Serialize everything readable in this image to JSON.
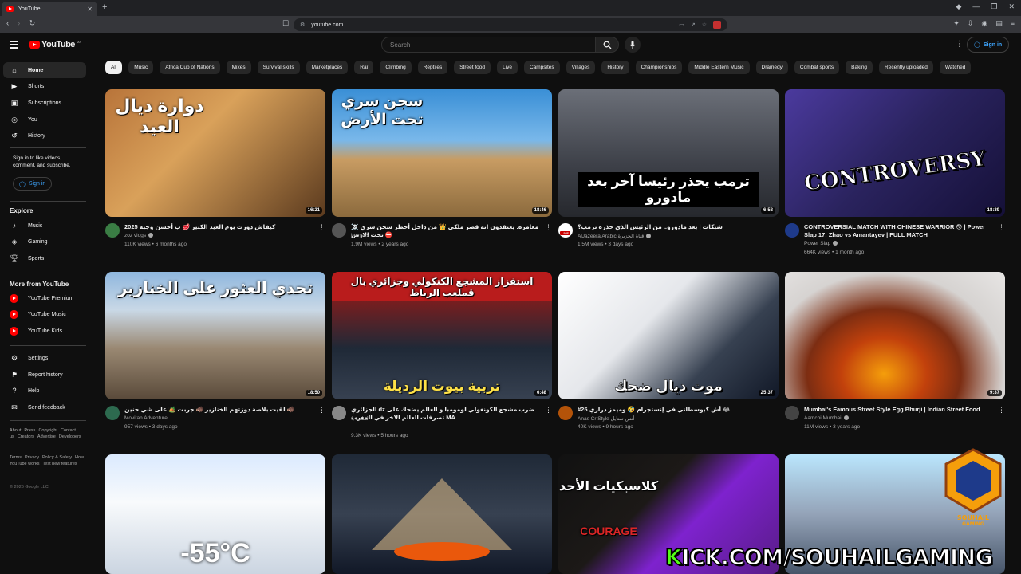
{
  "browser": {
    "tab_title": "YouTube",
    "url": "youtube.com"
  },
  "masthead": {
    "search_placeholder": "Search",
    "signin_label": "Sign in"
  },
  "sidebar": {
    "main": [
      {
        "label": "Home",
        "icon": "home-icon",
        "active": true
      },
      {
        "label": "Shorts",
        "icon": "shorts-icon"
      },
      {
        "label": "Subscriptions",
        "icon": "subscriptions-icon"
      },
      {
        "label": "You",
        "icon": "you-icon"
      },
      {
        "label": "History",
        "icon": "history-icon"
      }
    ],
    "signin_prompt": "Sign in to like videos, comment, and subscribe.",
    "signin_label": "Sign in",
    "explore_heading": "Explore",
    "explore": [
      {
        "label": "Music",
        "icon": "music-icon"
      },
      {
        "label": "Gaming",
        "icon": "gaming-icon"
      },
      {
        "label": "Sports",
        "icon": "sports-icon"
      }
    ],
    "more_heading": "More from YouTube",
    "more": [
      {
        "label": "YouTube Premium"
      },
      {
        "label": "YouTube Music"
      },
      {
        "label": "YouTube Kids"
      }
    ],
    "settings": [
      {
        "label": "Settings",
        "icon": "gear-icon"
      },
      {
        "label": "Report history",
        "icon": "flag-icon"
      },
      {
        "label": "Help",
        "icon": "help-icon"
      },
      {
        "label": "Send feedback",
        "icon": "feedback-icon"
      }
    ],
    "footer1": [
      "About",
      "Press",
      "Copyright",
      "Contact us",
      "Creators",
      "Advertise",
      "Developers"
    ],
    "footer2": [
      "Terms",
      "Privacy",
      "Policy & Safety",
      "How YouTube works",
      "Test new features"
    ],
    "copyright": "© 2026 Google LLC"
  },
  "chips": [
    "All",
    "Music",
    "Africa Cup of Nations",
    "Mixes",
    "Survival skills",
    "Marketplaces",
    "Raï",
    "Climbing",
    "Reptiles",
    "Street food",
    "Live",
    "Campsites",
    "Villages",
    "History",
    "Championships",
    "Middle Eastern Music",
    "Dramedy",
    "Combat sports",
    "Baking",
    "Recently uploaded",
    "Watched"
  ],
  "videos": [
    {
      "thumb_text": "دوارة ديال العيد",
      "duration": "16:21",
      "title": "كيفاش دوزت يوم العيد الكبير 🥩 ب أحسن وجبة 2025",
      "channel": "zoz vlogs",
      "stats": "110K views • 6 months ago",
      "avatar_color": "#3a7d44"
    },
    {
      "thumb_text": "سجن سري تحت الأرض",
      "duration": "18:46",
      "title": "☠️ مغامرة: يعتقدون انه قصر ملكي 👑 من داخل أخطر سجن سري تحت الارض ⛔",
      "channel": "bn nsns",
      "stats": "1.9M views • 2 years ago",
      "avatar_color": "#555"
    },
    {
      "thumb_text": "ترمب يحذر رئيسا آخر بعد مادورو",
      "duration": "6:58",
      "title": "شبكات | بعد مادورو.. من الرئيس الذي حذره ترمب؟",
      "channel": "AlJazeera Arabic قناة الجزيرة",
      "stats": "1.5M views • 3 days ago",
      "avatar_color": "#c8a14a"
    },
    {
      "thumb_text": "CONTROVERSY",
      "duration": "18:39",
      "title": "CONTROVERSIAL MATCH WITH CHINESE WARRIOR 😳 | Power Slap 17: Zhao vs Amantayev | FULL MATCH",
      "channel": "Power Slap",
      "stats": "664K views • 1 month ago",
      "avatar_color": "#1e3a8a"
    },
    {
      "thumb_text": "تحدي العثور على الخنازير",
      "duration": "18:50",
      "title": "لقيت بلاصة دوزتهم الخنازير 🐗 جربت 🏕️ على شي حنين 🐗",
      "channel": "Movitan Adventure",
      "stats": "957 views • 3 days ago",
      "avatar_color": "#2d6a4f"
    },
    {
      "thumb_text": "استفزاز المشجع الكنكولي وجزائري بال قملعب الرباط",
      "duration": "6:48",
      "title": "الجزائري dz ضرب مشجع الكونغولي لومومبا و العالم يضحك على تصرفات العالم الاخر في المغرب MA",
      "channel": "6 السعيد",
      "stats": "9.3K views • 5 hours ago",
      "avatar_color": "#888"
    },
    {
      "thumb_text": "موت ديال ضحك",
      "duration": "25:37",
      "title": "#25 أش كيوسطاني في إنستجرام 🤣 وميمز دراري 😂",
      "channel": "Anas Cr Style أنس ستايل",
      "stats": "40K views • 9 hours ago",
      "avatar_color": "#b45309"
    },
    {
      "thumb_text": "",
      "duration": "9:37",
      "title": "Mumbai's Famous Street Style Egg Bhurji | Indian Street Food",
      "channel": "Aamchi Mumbai",
      "stats": "11M views • 3 years ago",
      "avatar_color": "#444"
    }
  ],
  "overlay": {
    "kick_prefix": "K",
    "kick_rest": "ICK.COM/SOUHAILGAMING",
    "souhail": "SOUHAIL GAMING"
  }
}
